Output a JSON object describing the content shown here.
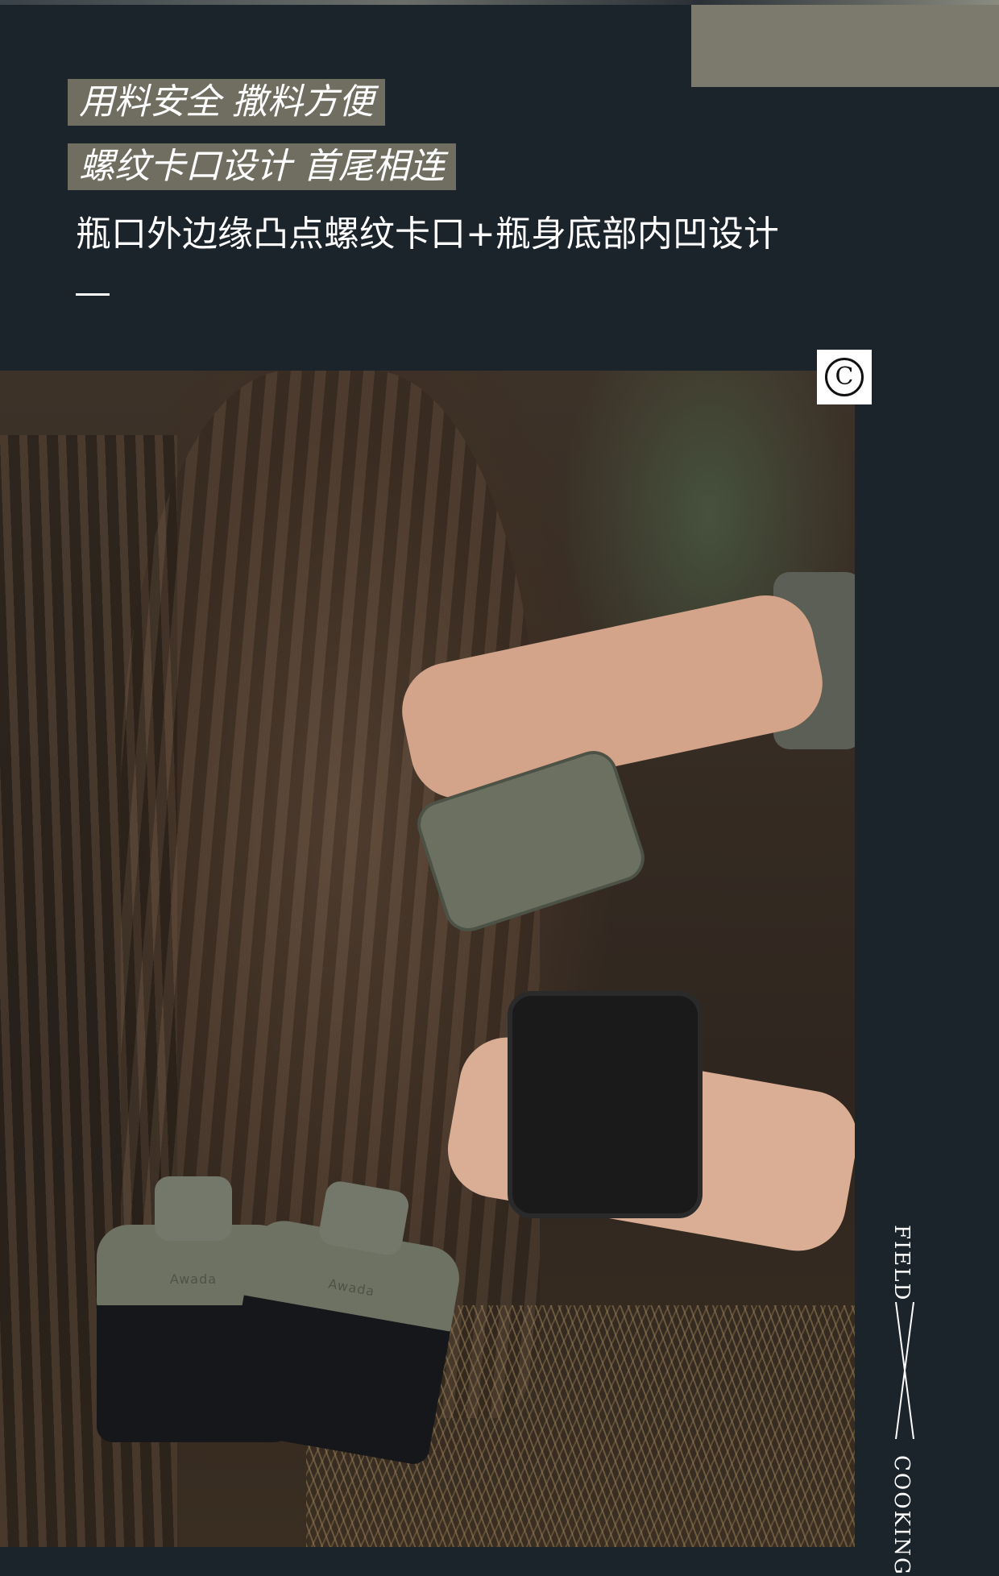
{
  "tags": [
    "用料安全 撒料方便",
    "螺纹卡口设计 首尾相连"
  ],
  "description": "瓶口外边缘凸点螺纹卡口+瓶身底部内凹设计",
  "copyright_symbol": "C",
  "side_labels": {
    "field": "FIELD",
    "cooking": "COOKING"
  },
  "jar_brand": "Awada",
  "colors": {
    "background": "#1b232b",
    "tag_bg": "#6f6e60",
    "khaki_block": "#7c7a6c",
    "text": "#ffffff"
  },
  "icons": {
    "copyright": "copyright-icon",
    "divider": "x-divider-icon"
  }
}
